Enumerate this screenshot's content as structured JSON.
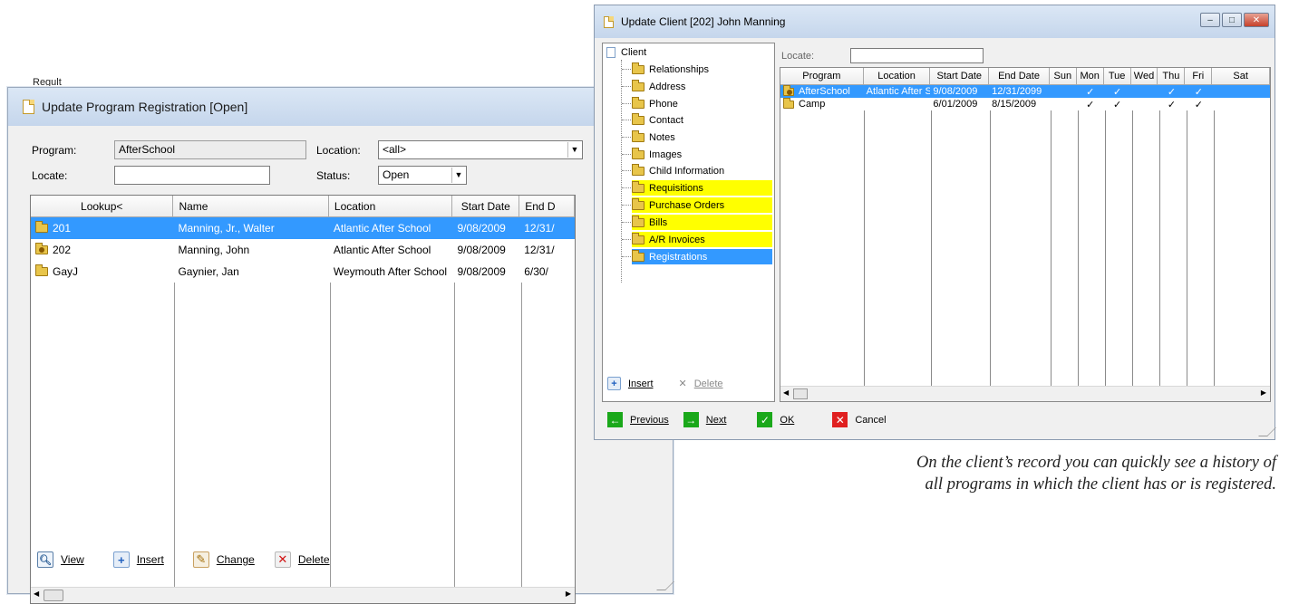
{
  "background_text": "Regult",
  "left_window": {
    "title": "Update Program Registration [Open]",
    "program_label": "Program:",
    "program_value": "AfterSchool",
    "location_label": "Location:",
    "location_value": "<all>",
    "locate_label": "Locate:",
    "locate_value": "",
    "status_label": "Status:",
    "status_value": "Open",
    "columns": [
      "Lookup<",
      "Name",
      "Location",
      "Start Date",
      "End D"
    ],
    "rows": [
      {
        "lookup": "201",
        "name": "Manning, Jr., Walter",
        "location": "Atlantic After School",
        "start": "9/08/2009",
        "end": "12/31/",
        "selected": true,
        "icon": "folder-icon"
      },
      {
        "lookup": "202",
        "name": "Manning, John",
        "location": "Atlantic After School",
        "start": "9/08/2009",
        "end": "12/31/",
        "selected": false,
        "icon": "folder-star-icon"
      },
      {
        "lookup": "GayJ",
        "name": "Gaynier, Jan",
        "location": "Weymouth After School",
        "start": "9/08/2009",
        "end": "6/30/",
        "selected": false,
        "icon": "folder-icon"
      }
    ],
    "buttons": {
      "view": "View",
      "insert": "Insert",
      "change": "Change",
      "delete": "Delete"
    }
  },
  "right_window": {
    "title": "Update Client [202] John Manning",
    "tree": {
      "root": "Client",
      "items": [
        {
          "label": "Relationships",
          "highlight": "none"
        },
        {
          "label": "Address",
          "highlight": "none"
        },
        {
          "label": "Phone",
          "highlight": "none"
        },
        {
          "label": "Contact",
          "highlight": "none"
        },
        {
          "label": "Notes",
          "highlight": "none"
        },
        {
          "label": "Images",
          "highlight": "none"
        },
        {
          "label": "Child Information",
          "highlight": "none"
        },
        {
          "label": "Requisitions",
          "highlight": "yellow"
        },
        {
          "label": "Purchase Orders",
          "highlight": "yellow"
        },
        {
          "label": "Bills",
          "highlight": "yellow"
        },
        {
          "label": "A/R Invoices",
          "highlight": "yellow"
        },
        {
          "label": "Registrations",
          "highlight": "selected"
        }
      ]
    },
    "locate_label": "Locate:",
    "locate_value": "",
    "columns": [
      "Program",
      "Location",
      "Start Date",
      "End Date",
      "Sun",
      "Mon",
      "Tue",
      "Wed",
      "Thu",
      "Fri",
      "Sat"
    ],
    "rows": [
      {
        "program": "AfterSchool",
        "location": "Atlantic After Sc",
        "start": "9/08/2009",
        "end": "12/31/2099",
        "days": [
          "",
          "✓",
          "✓",
          "",
          "✓",
          "✓",
          ""
        ],
        "selected": true,
        "icon": "folder-star-icon"
      },
      {
        "program": "Camp",
        "location": "",
        "start": "6/01/2009",
        "end": "8/15/2009",
        "days": [
          "",
          "✓",
          "✓",
          "",
          "✓",
          "✓",
          ""
        ],
        "selected": false,
        "icon": "folder-icon"
      }
    ],
    "tree_buttons": {
      "insert": "Insert",
      "delete": "Delete"
    },
    "footer_buttons": {
      "previous": "Previous",
      "next": "Next",
      "ok": "OK",
      "cancel": "Cancel"
    }
  },
  "caption": {
    "line1": "On the client’s record you can quickly see a history of",
    "line2": "all programs in which the client has or is registered."
  },
  "colors": {
    "selection": "#3399ff",
    "highlight": "#ffff00",
    "green": "#1aa81a",
    "red": "#e02020"
  }
}
